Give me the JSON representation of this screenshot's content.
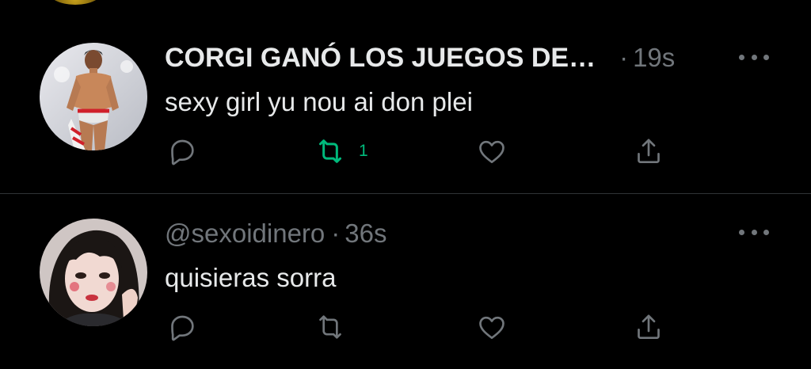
{
  "colors": {
    "background": "#000000",
    "text_primary": "#e7e9ea",
    "text_secondary": "#71767b",
    "divider": "#2f3336",
    "retweet_active": "#00ba7c"
  },
  "tweets": [
    {
      "display_name": "CORGI GANÓ LOS JUEGOS DE…",
      "separator": "·",
      "timestamp": "19s",
      "text": "sexy girl yu nou ai don plei",
      "retweeted": true,
      "retweet_count": "1",
      "icons": [
        "reply-icon",
        "retweet-icon",
        "like-icon",
        "share-icon",
        "more-icon"
      ]
    },
    {
      "handle": "@sexoidinero",
      "separator": "·",
      "timestamp": "36s",
      "text": "quisieras sorra",
      "retweeted": false,
      "icons": [
        "reply-icon",
        "retweet-icon",
        "like-icon",
        "share-icon",
        "more-icon"
      ]
    }
  ]
}
